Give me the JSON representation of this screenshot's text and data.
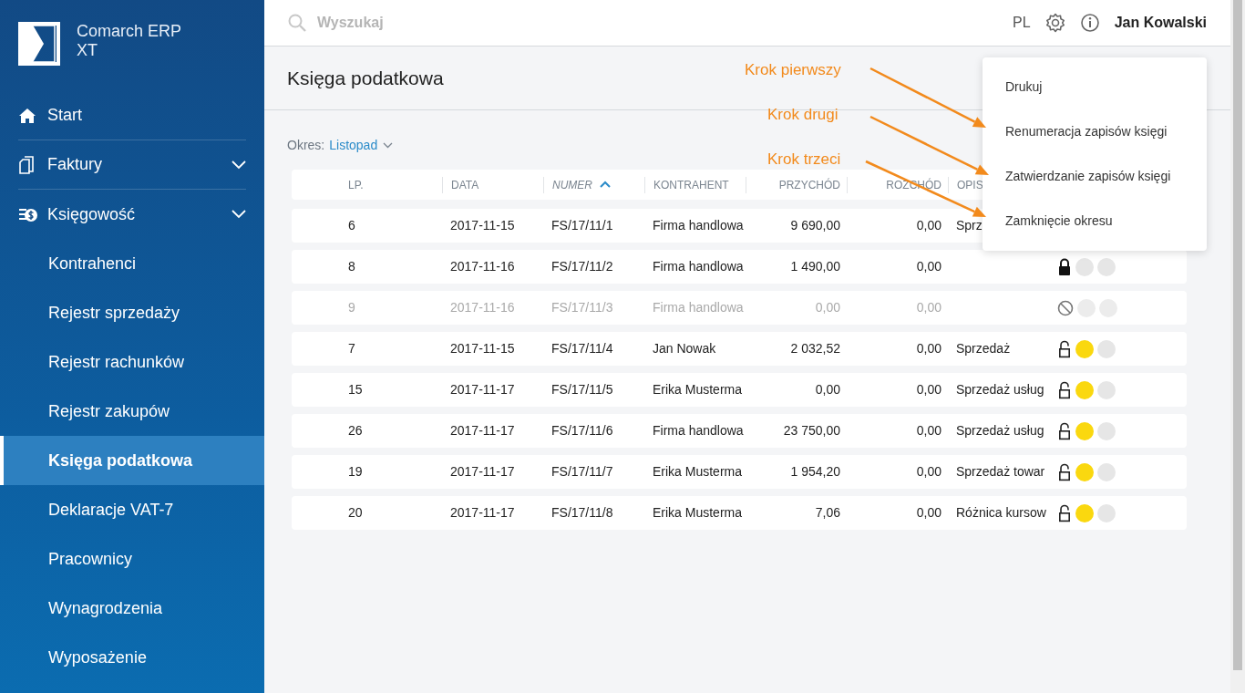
{
  "app": {
    "name": "Comarch ERP",
    "edition": "XT"
  },
  "sidebar": {
    "items": [
      {
        "label": "Start",
        "kind": "home",
        "expandable": false
      },
      {
        "label": "Faktury",
        "kind": "documents",
        "expandable": true
      },
      {
        "label": "Księgowość",
        "kind": "money",
        "expandable": true,
        "children": [
          {
            "label": "Kontrahenci",
            "selected": false
          },
          {
            "label": "Rejestr sprzedaży",
            "selected": false
          },
          {
            "label": "Rejestr rachunków",
            "selected": false
          },
          {
            "label": "Rejestr zakupów",
            "selected": false
          },
          {
            "label": "Księga podatkowa",
            "selected": true
          },
          {
            "label": "Deklaracje VAT-7",
            "selected": false
          },
          {
            "label": "Pracownicy",
            "selected": false
          },
          {
            "label": "Wynagrodzenia",
            "selected": false
          },
          {
            "label": "Wyposażenie",
            "selected": false
          }
        ]
      }
    ]
  },
  "topbar": {
    "search": {
      "placeholder": "Wyszukaj"
    },
    "language": "PL",
    "user": "Jan Kowalski"
  },
  "page": {
    "title": "Księga podatkowa",
    "period_label": "Okres:",
    "period_value": "Listopad"
  },
  "table": {
    "columns": [
      {
        "label": "LP.",
        "sorted": false
      },
      {
        "label": "DATA",
        "sorted": false
      },
      {
        "label": "NUMER",
        "sorted": true
      },
      {
        "label": "KONTRAHENT",
        "sorted": false
      },
      {
        "label": "PRZYCHÓD",
        "sorted": false
      },
      {
        "label": "ROZCHÓD",
        "sorted": false
      },
      {
        "label": "OPIS",
        "sorted": false
      }
    ],
    "rows": [
      {
        "cells": [
          "6",
          "2017-11-15",
          "FS/17/11/1",
          "Firma handlowa",
          "9 690,00",
          "0,00",
          "Sprz"
        ],
        "disabled": false
      },
      {
        "cells": [
          "8",
          "2017-11-16",
          "FS/17/11/2",
          "Firma handlowa",
          "1 490,00",
          "0,00",
          ""
        ],
        "disabled": false,
        "kind": "locked",
        "approved": false
      },
      {
        "cells": [
          "9",
          "2017-11-16",
          "FS/17/11/3",
          "Firma handlowa",
          "0,00",
          "0,00",
          ""
        ],
        "disabled": true,
        "kind": "cancelled",
        "approved": false
      },
      {
        "cells": [
          "7",
          "2017-11-15",
          "FS/17/11/4",
          "Jan Nowak",
          "2 032,52",
          "0,00",
          "Sprzedaż"
        ],
        "disabled": false,
        "kind": "unlocked",
        "approved": true
      },
      {
        "cells": [
          "15",
          "2017-11-17",
          "FS/17/11/5",
          "Erika Musterma",
          "0,00",
          "0,00",
          "Sprzedaż usług"
        ],
        "disabled": false,
        "kind": "unlocked",
        "approved": true
      },
      {
        "cells": [
          "26",
          "2017-11-17",
          "FS/17/11/6",
          "Firma handlowa",
          "23 750,00",
          "0,00",
          "Sprzedaż usług"
        ],
        "disabled": false,
        "kind": "unlocked",
        "approved": true
      },
      {
        "cells": [
          "19",
          "2017-11-17",
          "FS/17/11/7",
          "Erika Musterma",
          "1 954,20",
          "0,00",
          "Sprzedaż towar"
        ],
        "disabled": false,
        "kind": "unlocked",
        "approved": true
      },
      {
        "cells": [
          "20",
          "2017-11-17",
          "FS/17/11/8",
          "Erika Musterma",
          "7,06",
          "0,00",
          "Różnica kursow"
        ],
        "disabled": false,
        "kind": "unlocked",
        "approved": true
      }
    ]
  },
  "menu": {
    "items": [
      "Drukuj",
      "Renumeracja zapisów księgi",
      "Zatwierdzanie zapisów księgi",
      "Zamknięcie okresu"
    ]
  },
  "annotations": [
    {
      "text": "Krok pierwszy"
    },
    {
      "text": "Krok drugi"
    },
    {
      "text": "Krok trzeci"
    }
  ]
}
